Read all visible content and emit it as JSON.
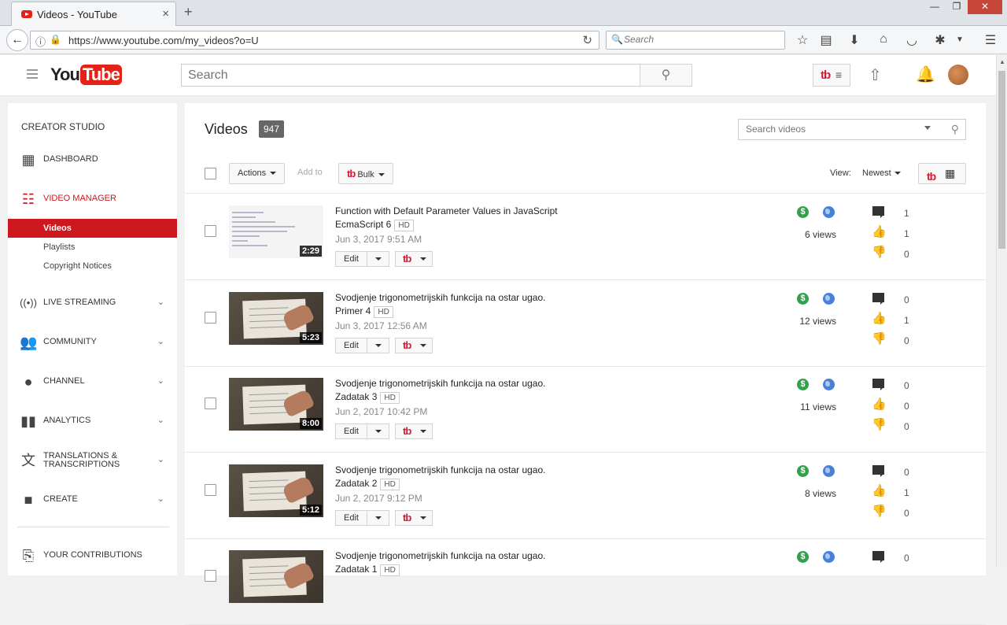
{
  "browser": {
    "tab_title": "Videos - YouTube",
    "url": "https://www.youtube.com/my_videos?o=U",
    "search_placeholder": "Search"
  },
  "header": {
    "search_placeholder": "Search",
    "logo_you": "You",
    "logo_tube": "Tube"
  },
  "sidebar": {
    "title": "CREATOR STUDIO",
    "items": [
      {
        "label": "DASHBOARD",
        "icon": "dashboard-icon"
      },
      {
        "label": "VIDEO MANAGER",
        "icon": "video-manager-icon"
      },
      {
        "label": "LIVE STREAMING",
        "icon": "live-streaming-icon"
      },
      {
        "label": "COMMUNITY",
        "icon": "community-icon"
      },
      {
        "label": "CHANNEL",
        "icon": "channel-icon"
      },
      {
        "label": "ANALYTICS",
        "icon": "analytics-icon"
      },
      {
        "label": "TRANSLATIONS & TRANSCRIPTIONS",
        "icon": "translate-icon"
      },
      {
        "label": "CREATE",
        "icon": "create-icon"
      },
      {
        "label": "YOUR CONTRIBUTIONS",
        "icon": "contributions-icon"
      }
    ],
    "sub_items": [
      {
        "label": "Videos"
      },
      {
        "label": "Playlists"
      },
      {
        "label": "Copyright Notices"
      }
    ],
    "accent_color": "#cc181e"
  },
  "main": {
    "title": "Videos",
    "count": "947",
    "search_placeholder": "Search videos",
    "actions_label": "Actions",
    "add_to_label": "Add to",
    "bulk_label": "Bulk",
    "view_label": "View:",
    "sort_label": "Newest",
    "edit_label": "Edit",
    "hd_label": "HD",
    "videos": [
      {
        "title": "Function with Default Parameter Values in JavaScript EcmaScript 6",
        "date": "Jun 3, 2017 9:51 AM",
        "duration": "2:29",
        "views": "6 views",
        "comments": "1",
        "likes": "1",
        "dislikes": "0",
        "thumb": "code"
      },
      {
        "title": "Svodjenje trigonometrijskih funkcija na ostar ugao. Primer 4",
        "date": "Jun 3, 2017 12:56 AM",
        "duration": "5:23",
        "views": "12 views",
        "comments": "0",
        "likes": "1",
        "dislikes": "0",
        "thumb": "paper"
      },
      {
        "title": "Svodjenje trigonometrijskih funkcija na ostar ugao. Zadatak 3",
        "date": "Jun 2, 2017 10:42 PM",
        "duration": "8:00",
        "views": "11 views",
        "comments": "0",
        "likes": "0",
        "dislikes": "0",
        "thumb": "paper"
      },
      {
        "title": "Svodjenje trigonometrijskih funkcija na ostar ugao. Zadatak 2",
        "date": "Jun 2, 2017 9:12 PM",
        "duration": "5:12",
        "views": "8 views",
        "comments": "0",
        "likes": "1",
        "dislikes": "0",
        "thumb": "paper"
      },
      {
        "title": "Svodjenje trigonometrijskih funkcija na ostar ugao. Zadatak 1",
        "date": "",
        "duration": "",
        "views": "",
        "comments": "0",
        "likes": "",
        "dislikes": "",
        "thumb": "paper"
      }
    ]
  }
}
